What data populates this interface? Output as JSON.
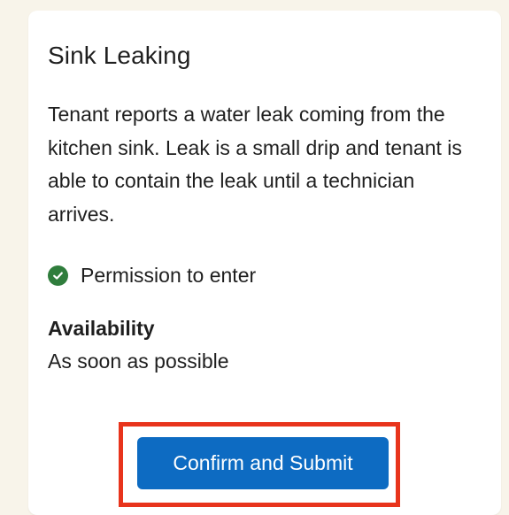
{
  "ticket": {
    "title": "Sink Leaking",
    "description": "Tenant reports a water leak coming from the kitchen sink. Leak is a small drip and tenant is able to contain the leak until a technician arrives.",
    "permission": {
      "icon": "check-circle-icon",
      "label": "Permission to enter",
      "color": "#2f7d3c"
    },
    "availability": {
      "heading": "Availability",
      "value": "As soon as possible"
    }
  },
  "actions": {
    "submit_label": "Confirm and Submit",
    "submit_color": "#0d6bc2",
    "highlight_color": "#e8341c"
  }
}
